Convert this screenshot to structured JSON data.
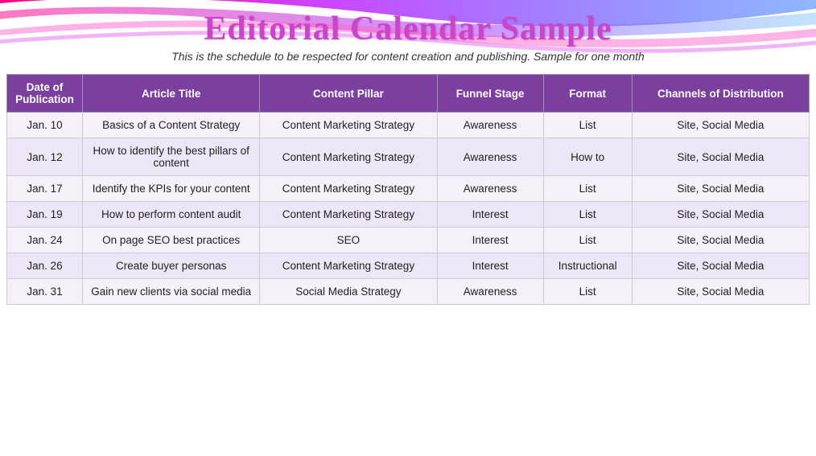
{
  "header": {
    "title": "Editorial Calendar Sample",
    "subtitle": "This is the schedule to be respected for content creation and publishing. Sample for one month"
  },
  "table": {
    "columns": [
      {
        "key": "date",
        "label": "Date of Publication"
      },
      {
        "key": "title",
        "label": "Article Title"
      },
      {
        "key": "pillar",
        "label": "Content Pillar"
      },
      {
        "key": "funnel",
        "label": "Funnel Stage"
      },
      {
        "key": "format",
        "label": "Format"
      },
      {
        "key": "channels",
        "label": "Channels of Distribution"
      }
    ],
    "rows": [
      {
        "date": "Jan. 10",
        "title": "Basics of a Content Strategy",
        "pillar": "Content Marketing Strategy",
        "funnel": "Awareness",
        "format": "List",
        "channels": "Site, Social Media"
      },
      {
        "date": "Jan. 12",
        "title": "How to identify the best pillars of content",
        "pillar": "Content Marketing Strategy",
        "funnel": "Awareness",
        "format": "How to",
        "channels": "Site, Social Media"
      },
      {
        "date": "Jan. 17",
        "title": "Identify the KPIs for your content",
        "pillar": "Content Marketing Strategy",
        "funnel": "Awareness",
        "format": "List",
        "channels": "Site, Social Media"
      },
      {
        "date": "Jan. 19",
        "title": "How to perform content audit",
        "pillar": "Content Marketing Strategy",
        "funnel": "Interest",
        "format": "List",
        "channels": "Site, Social Media"
      },
      {
        "date": "Jan. 24",
        "title": "On page SEO best practices",
        "pillar": "SEO",
        "funnel": "Interest",
        "format": "List",
        "channels": "Site, Social Media"
      },
      {
        "date": "Jan. 26",
        "title": "Create buyer personas",
        "pillar": "Content Marketing Strategy",
        "funnel": "Interest",
        "format": "Instructional",
        "channels": "Site, Social Media"
      },
      {
        "date": "Jan. 31",
        "title": "Gain new clients via social media",
        "pillar": "Social Media Strategy",
        "funnel": "Awareness",
        "format": "List",
        "channels": "Site, Social Media"
      }
    ]
  },
  "colors": {
    "header_bg": "#7b3fa0",
    "title_color": "#cc44cc",
    "row_odd": "#f5f0fa",
    "row_even": "#ede6f7"
  }
}
